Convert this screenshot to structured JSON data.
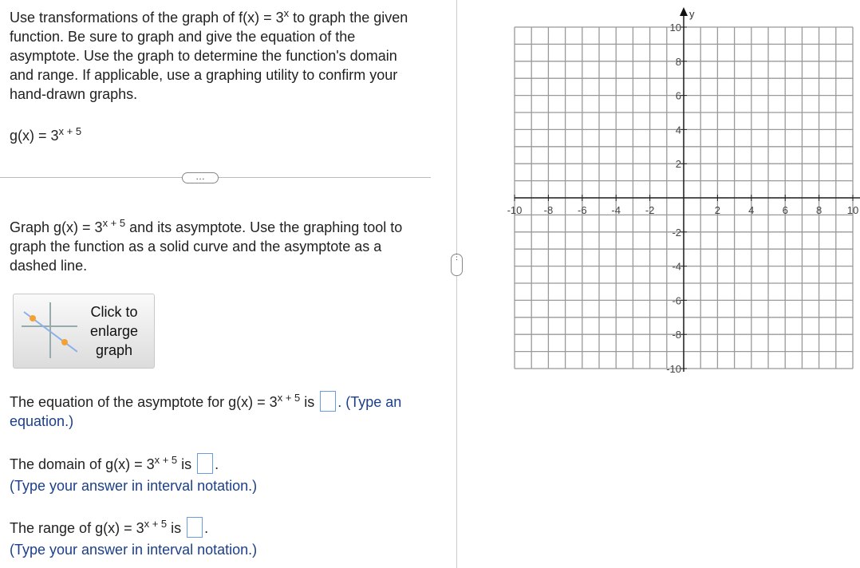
{
  "intro": {
    "text": "Use transformations of the graph of f(x) = 3",
    "sup": "x",
    "rest": " to graph the given function. Be sure to graph and give the equation of the asymptote. Use the graph to determine the function's domain and range. If applicable, use a graphing utility to confirm your hand-drawn graphs."
  },
  "func": {
    "base": "g(x) = 3",
    "exp": "x + 5"
  },
  "divider_dots": "…",
  "graph_instr": {
    "pre": "Graph g(x) = 3",
    "exp": "x + 5",
    "post": " and its asymptote. Use the graphing tool to graph the function as a solid curve and the asymptote as a dashed line."
  },
  "enlarge_button": "Click to enlarge graph",
  "q_asymptote": {
    "pre": "The equation of the asymptote for g(x) = 3",
    "exp": "x + 5",
    "mid": " is ",
    "post": ". (Type an equation.)"
  },
  "q_domain": {
    "pre": "The domain of g(x) = 3",
    "exp": "x + 5",
    "mid": " is ",
    "post": ".",
    "hint": "(Type your answer in interval notation.)"
  },
  "q_range": {
    "pre": "The range of g(x) = 3",
    "exp": "x + 5",
    "mid": " is ",
    "post": ".",
    "hint": "(Type your answer in interval notation.)"
  },
  "chart_data": {
    "type": "scatter",
    "xlim": [
      -10,
      10
    ],
    "ylim": [
      -10,
      10
    ],
    "grid": true,
    "ylabel": "y",
    "xticks": [
      "-10",
      "-8",
      "-6",
      "-4",
      "-2",
      "2",
      "4",
      "6",
      "8",
      "10"
    ],
    "yticks": [
      "10",
      "8",
      "6",
      "4",
      "2",
      "-2",
      "-4",
      "-6",
      "-8",
      "-10"
    ],
    "series": []
  }
}
